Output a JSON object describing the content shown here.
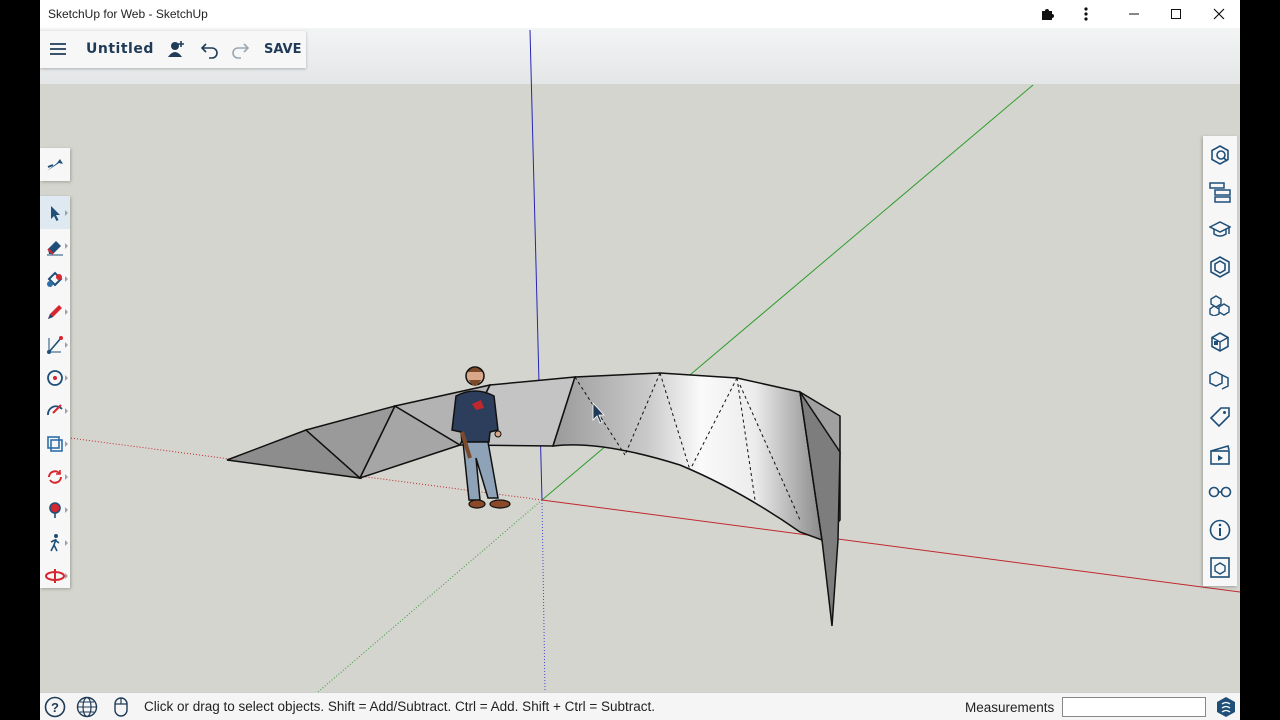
{
  "window": {
    "title": "SketchUp for Web - SketchUp",
    "controls": [
      "extensions",
      "more",
      "minimize",
      "maximize",
      "close"
    ]
  },
  "file_toolbar": {
    "menu_icon": "hamburger-icon",
    "document_title": "Untitled",
    "share_icon": "add-user-icon",
    "undo_icon": "undo-icon",
    "redo_icon": "redo-icon",
    "save_label": "SAVE"
  },
  "left_toolbar": {
    "top_tool": "search-tools-icon",
    "tools": [
      {
        "name": "select-tool",
        "icon": "arrow-cursor-icon",
        "active": true
      },
      {
        "name": "eraser-tool",
        "icon": "eraser-icon"
      },
      {
        "name": "paint-bucket-tool",
        "icon": "paint-bucket-icon"
      },
      {
        "name": "pencil-tool",
        "icon": "pencil-icon"
      },
      {
        "name": "line-tool",
        "icon": "line-icon"
      },
      {
        "name": "circle-tool",
        "icon": "circle-icon"
      },
      {
        "name": "arc-tool",
        "icon": "arc-icon"
      },
      {
        "name": "offset-tool",
        "icon": "offset-icon"
      },
      {
        "name": "rotate-tool",
        "icon": "rotate-icon"
      },
      {
        "name": "position-camera-tool",
        "icon": "camera-position-icon"
      },
      {
        "name": "walk-tool",
        "icon": "walk-icon"
      },
      {
        "name": "section-plane-tool",
        "icon": "section-plane-icon"
      }
    ]
  },
  "right_toolbar": {
    "panels": [
      "entity-info-icon",
      "outliner-icon",
      "instructor-icon",
      "components-icon",
      "3d-warehouse-icon",
      "materials-icon",
      "solid-tools-icon",
      "tags-icon",
      "scenes-icon",
      "display-icon",
      "info-icon",
      "view-icon"
    ]
  },
  "status_bar": {
    "help_icon": "help-icon",
    "globe_icon": "globe-icon",
    "mouse_icon": "mouse-icon",
    "message": "Click or drag to select objects. Shift = Add/Subtract. Ctrl = Add. Shift + Ctrl = Subtract.",
    "measurements_label": "Measurements",
    "measurements_value": "",
    "logo_icon": "sketchup-logo-icon"
  },
  "colors": {
    "ground": "#d5d5cf",
    "sky": "#e9ebec",
    "axis_red": "#c0282d",
    "axis_green": "#2e9d2e",
    "axis_blue": "#2626b4",
    "toolbar_icon": "#1f4f78",
    "tool_accent": "#d6262f"
  }
}
